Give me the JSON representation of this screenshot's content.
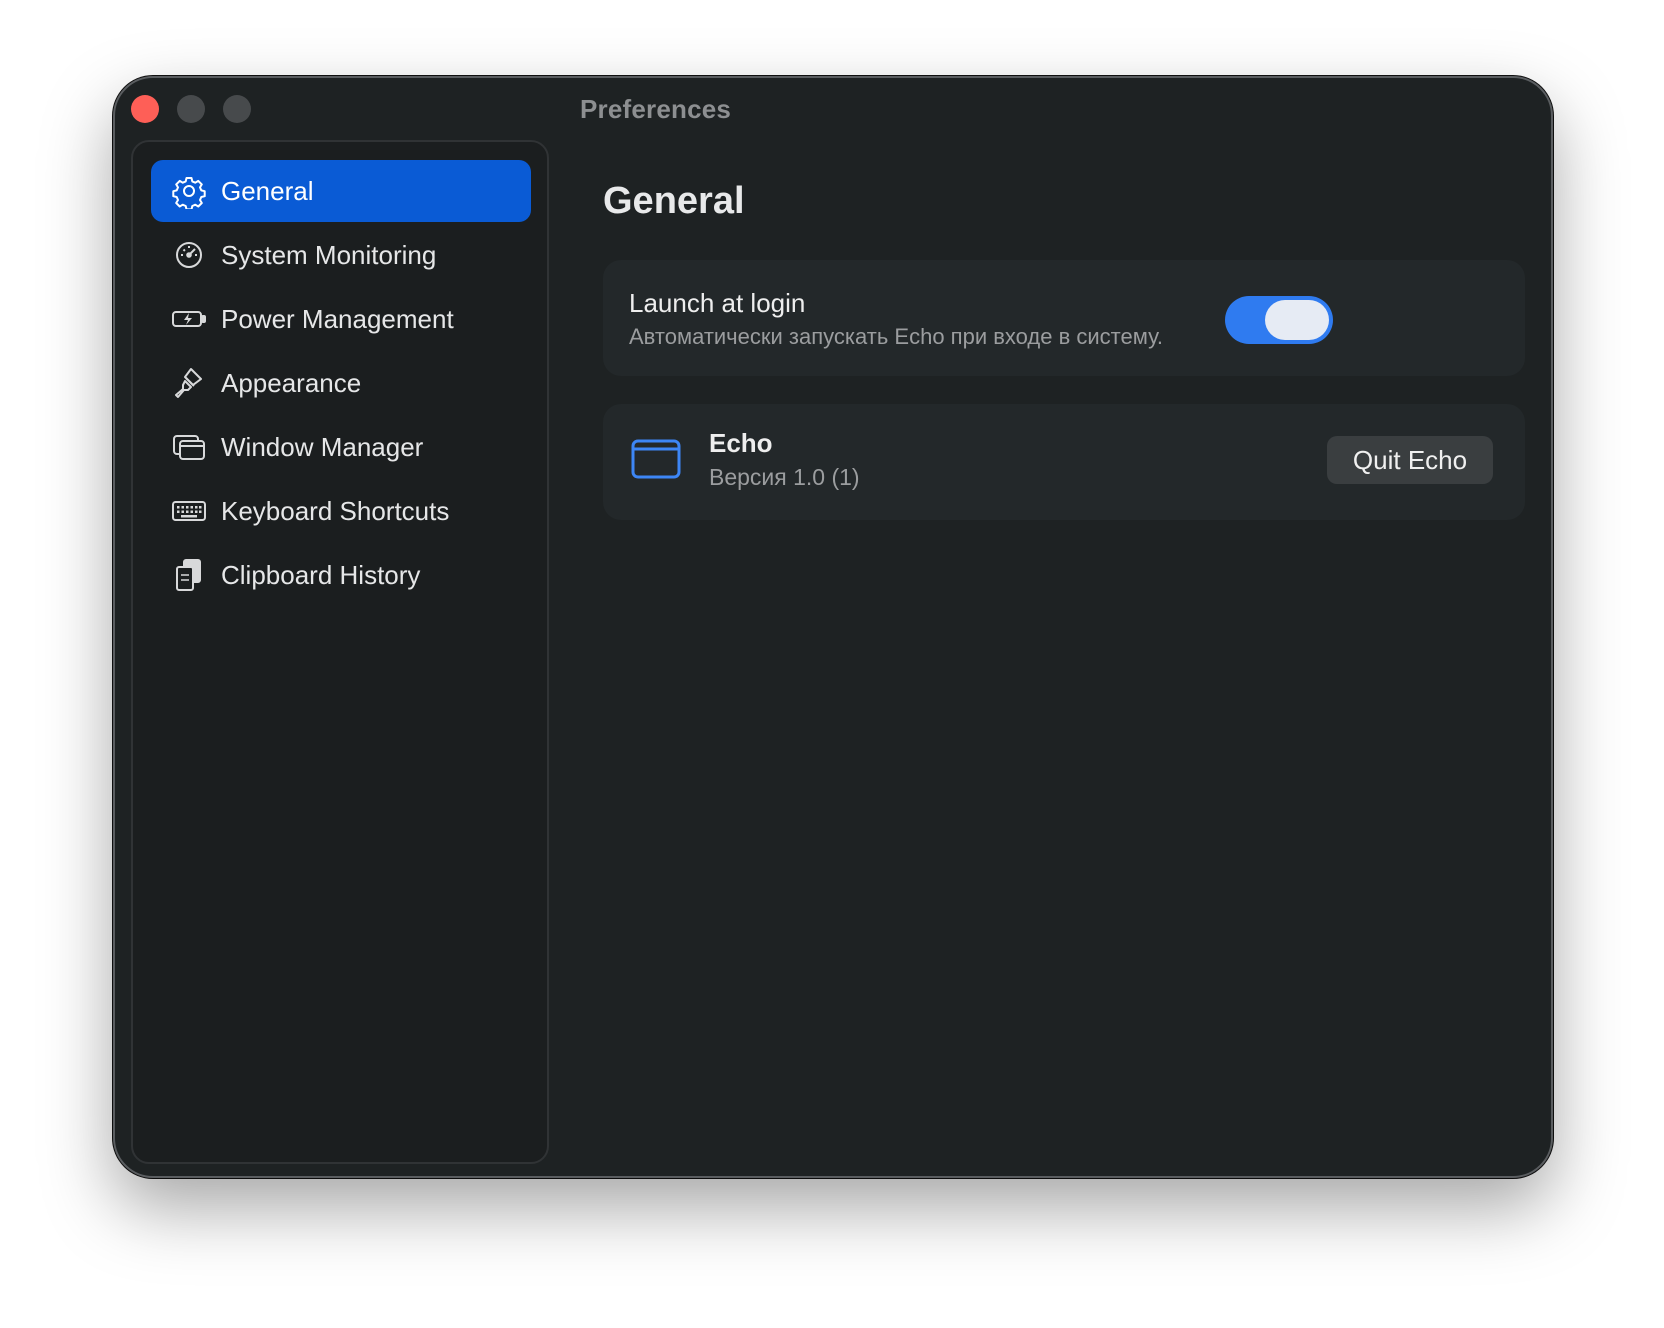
{
  "window": {
    "title": "Preferences",
    "controls": [
      "close",
      "minimize",
      "maximize"
    ],
    "colors": {
      "background": "#1e2223",
      "sidebar": "#1b1e1f",
      "accent": "#0a5bd5",
      "toggle_on": "#2f7bf0",
      "close": "#fe5f57"
    }
  },
  "sidebar": {
    "items": [
      {
        "label": "General",
        "icon": "gear-icon",
        "active": true
      },
      {
        "label": "System Monitoring",
        "icon": "gauge-icon",
        "active": false
      },
      {
        "label": "Power Management",
        "icon": "battery-charging-icon",
        "active": false
      },
      {
        "label": "Appearance",
        "icon": "paintbrush-icon",
        "active": false
      },
      {
        "label": "Window Manager",
        "icon": "windows-icon",
        "active": false
      },
      {
        "label": "Keyboard Shortcuts",
        "icon": "keyboard-icon",
        "active": false
      },
      {
        "label": "Clipboard History",
        "icon": "clipboard-icon",
        "active": false
      }
    ]
  },
  "main": {
    "title": "General",
    "launch": {
      "title": "Launch at login",
      "subtitle": "Автоматически запускать Echo при входе в систему.",
      "enabled": true
    },
    "app": {
      "icon": "app-window-icon",
      "name": "Echo",
      "version": "Версия 1.0 (1)",
      "quit_label": "Quit Echo"
    }
  }
}
